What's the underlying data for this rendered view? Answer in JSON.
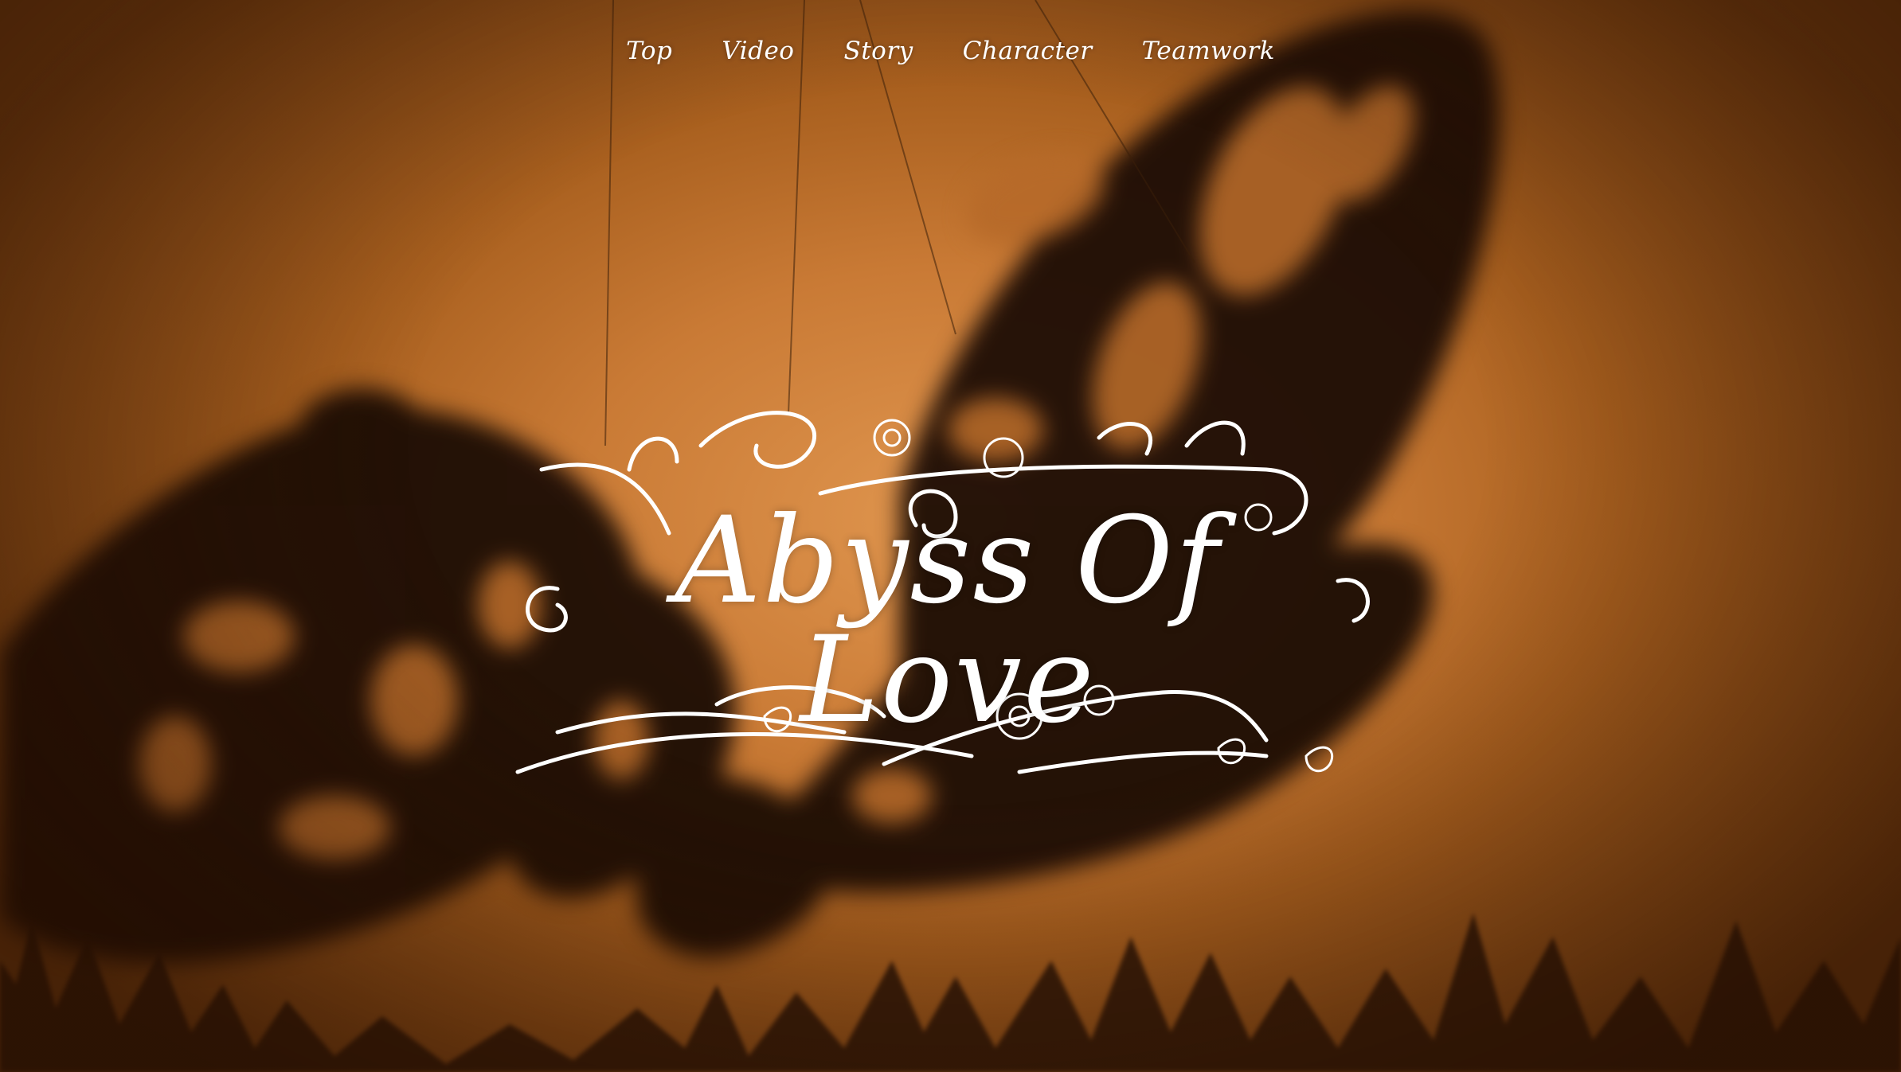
{
  "nav": {
    "items": [
      {
        "label": "Top"
      },
      {
        "label": "Video"
      },
      {
        "label": "Story"
      },
      {
        "label": "Character"
      },
      {
        "label": "Teamwork"
      }
    ]
  },
  "hero": {
    "logo_text": "Abyss Of Love",
    "background": "butterfly-shadow-puppet",
    "colors": {
      "backdrop": "#c97a35",
      "shadow": "#1a0c04",
      "logo": "#ffffff"
    }
  }
}
